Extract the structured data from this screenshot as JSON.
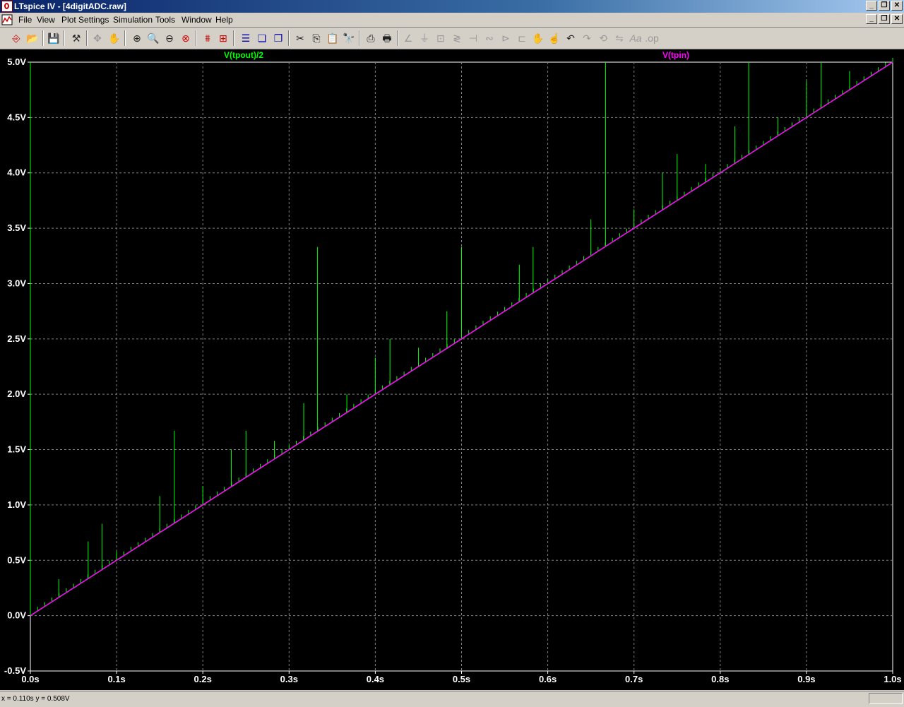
{
  "window": {
    "title": "LTspice IV - [4digitADC.raw]"
  },
  "menu": {
    "items": [
      "File",
      "View",
      "Plot Settings",
      "Simulation",
      "Tools",
      "Window",
      "Help"
    ]
  },
  "toolbar": {
    "icons": [
      "new-schematic-icon",
      "open-icon",
      "save-icon",
      "control-panel-icon",
      "move-icon",
      "pan-icon",
      "zoom-in-icon",
      "zoom-area-icon",
      "zoom-out-icon",
      "zoom-cancel-icon",
      "autorange-icon",
      "tile-vertical-icon",
      "tile-horizontal-icon",
      "cascade-icon",
      "close-all-icon",
      "cut-icon",
      "copy-icon",
      "paste-icon",
      "find-icon",
      "print-preview-icon",
      "print-icon",
      "wire-icon",
      "ground-icon",
      "label-icon",
      "resistor-icon",
      "capacitor-icon",
      "inductor-icon",
      "diode-icon",
      "component-icon",
      "drag-icon",
      "move-hand-icon",
      "undo-icon",
      "redo-icon",
      "rotate-icon",
      "mirror-icon",
      "text-icon",
      "spice-directive-icon"
    ]
  },
  "plot": {
    "background": "#000000",
    "grid_color": "#808080",
    "traces": [
      {
        "label": "V(tpout)/2",
        "color": "#00ff00"
      },
      {
        "label": "V(tpin)",
        "color": "#ff00ff"
      }
    ]
  },
  "chart_data": {
    "type": "line",
    "title": "",
    "xlabel": "",
    "ylabel": "",
    "xlim": [
      0,
      1.0
    ],
    "ylim": [
      -0.5,
      5.0
    ],
    "grid": true,
    "x_ticks": [
      "0.0s",
      "0.1s",
      "0.2s",
      "0.3s",
      "0.4s",
      "0.5s",
      "0.6s",
      "0.7s",
      "0.8s",
      "0.9s",
      "1.0s"
    ],
    "y_ticks": [
      "-0.5V",
      "0.0V",
      "0.5V",
      "1.0V",
      "1.5V",
      "2.0V",
      "2.5V",
      "3.0V",
      "3.5V",
      "4.0V",
      "4.5V",
      "5.0V"
    ],
    "series": [
      {
        "name": "V(tpin)",
        "x": [
          0.0,
          1.0
        ],
        "y": [
          0.0,
          5.0
        ]
      },
      {
        "name": "V(tpout)/2",
        "x": [
          0.0,
          1.0
        ],
        "y": [
          0.0,
          5.0
        ],
        "spikes": [
          {
            "x": 0.0,
            "y": 5.0
          },
          {
            "x": 0.033,
            "y": 0.33
          },
          {
            "x": 0.067,
            "y": 0.67
          },
          {
            "x": 0.083,
            "y": 0.83
          },
          {
            "x": 0.1,
            "y": 0.58
          },
          {
            "x": 0.15,
            "y": 1.08
          },
          {
            "x": 0.167,
            "y": 1.67
          },
          {
            "x": 0.2,
            "y": 1.17
          },
          {
            "x": 0.233,
            "y": 1.5
          },
          {
            "x": 0.25,
            "y": 1.67
          },
          {
            "x": 0.283,
            "y": 1.58
          },
          {
            "x": 0.317,
            "y": 1.92
          },
          {
            "x": 0.333,
            "y": 3.33
          },
          {
            "x": 0.367,
            "y": 2.0
          },
          {
            "x": 0.4,
            "y": 2.33
          },
          {
            "x": 0.417,
            "y": 2.5
          },
          {
            "x": 0.45,
            "y": 2.42
          },
          {
            "x": 0.483,
            "y": 2.75
          },
          {
            "x": 0.5,
            "y": 3.33
          },
          {
            "x": 0.567,
            "y": 3.17
          },
          {
            "x": 0.583,
            "y": 3.33
          },
          {
            "x": 0.65,
            "y": 3.58
          },
          {
            "x": 0.667,
            "y": 5.0
          },
          {
            "x": 0.7,
            "y": 3.67
          },
          {
            "x": 0.733,
            "y": 4.0
          },
          {
            "x": 0.75,
            "y": 4.17
          },
          {
            "x": 0.783,
            "y": 4.08
          },
          {
            "x": 0.817,
            "y": 4.42
          },
          {
            "x": 0.833,
            "y": 5.0
          },
          {
            "x": 0.867,
            "y": 4.5
          },
          {
            "x": 0.9,
            "y": 4.83
          },
          {
            "x": 0.917,
            "y": 5.0
          },
          {
            "x": 0.95,
            "y": 4.92
          }
        ]
      }
    ]
  },
  "status": {
    "text": "x = 0.110s    y = 0.508V"
  }
}
